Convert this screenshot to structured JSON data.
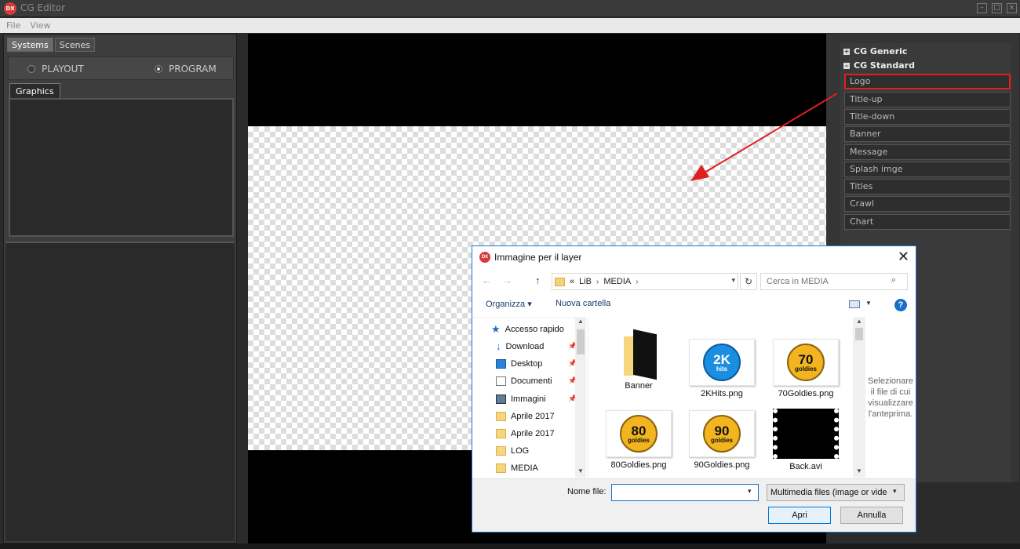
{
  "app": {
    "title": "CG Editor",
    "logo_text": "DX"
  },
  "menu": [
    "File",
    "View"
  ],
  "left": {
    "tabs": [
      "Systems",
      "Scenes"
    ],
    "radios": [
      {
        "label": "PLAYOUT",
        "checked": false
      },
      {
        "label": "PROGRAM",
        "checked": true
      }
    ],
    "graphics_tab": "Graphics"
  },
  "right": {
    "groups": [
      "CG Generic",
      "CG Standard"
    ],
    "items": [
      "Logo",
      "Title-up",
      "Title-down",
      "Banner",
      "Message",
      "Splash imge",
      "Titles",
      "Crawl",
      "Chart"
    ],
    "selected": "Logo"
  },
  "dialog": {
    "title": "Immagine per il layer",
    "path": [
      "LiB",
      "MEDIA"
    ],
    "path_prefix": "«",
    "search_placeholder": "Cerca in MEDIA",
    "toolbar": {
      "organize": "Organizza",
      "new_folder": "Nuova cartella"
    },
    "nav": {
      "root": "Accesso rapido",
      "items": [
        "Download",
        "Desktop",
        "Documenti",
        "Immagini",
        "Aprile 2017",
        "Aprile 2017",
        "LOG",
        "MEDIA"
      ]
    },
    "files": [
      {
        "name": "Banner"
      },
      {
        "name": "2KHits.png",
        "badge_big": "2K",
        "badge_small": "hits"
      },
      {
        "name": "70Goldies.png",
        "badge_big": "70",
        "badge_small": "goldies"
      },
      {
        "name": "80Goldies.png",
        "badge_big": "80",
        "badge_small": "goldies"
      },
      {
        "name": "90Goldies.png",
        "badge_big": "90",
        "badge_small": "goldies"
      },
      {
        "name": "Back.avi"
      }
    ],
    "preview_text": "Selezionare il file di cui visualizzare l'anteprima.",
    "filename_label": "Nome file:",
    "filename_value": "",
    "filetype": "Multimedia files (image or vide",
    "open_label": "Apri",
    "cancel_label": "Annulla"
  },
  "colors": {
    "highlight": "#e11f1f",
    "accent": "#1a6fc9"
  }
}
